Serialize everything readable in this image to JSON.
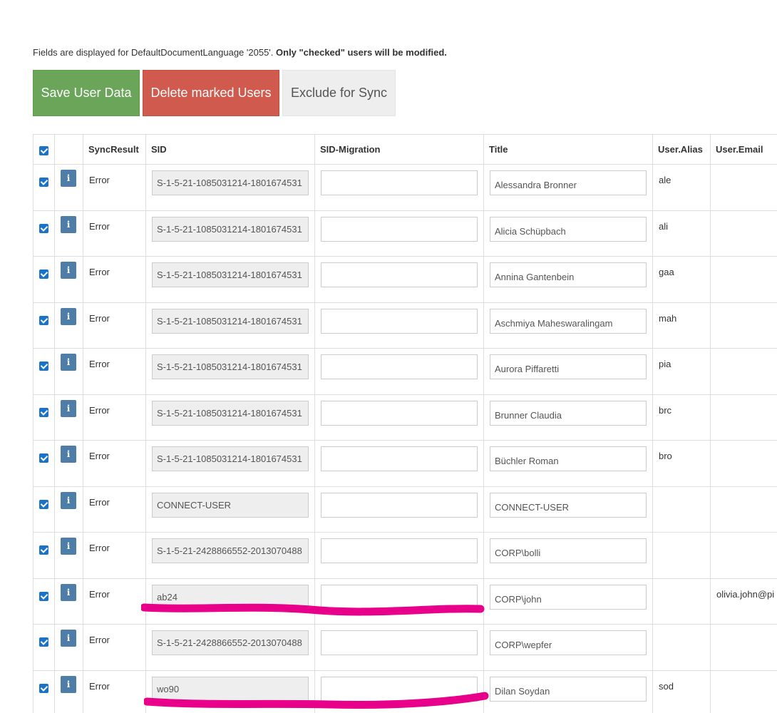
{
  "info": {
    "prefix": "Fields are displayed for DefaultDocumentLanguage '2055'. ",
    "bold": "Only \"checked\" users will be modified."
  },
  "toolbar": {
    "save_label": "Save User Data",
    "delete_label": "Delete marked Users",
    "exclude_label": "Exclude for Sync"
  },
  "table": {
    "headers": {
      "syncresult": "SyncResult",
      "sid": "SID",
      "sid_migration": "SID-Migration",
      "title": "Title",
      "alias": "User.Alias",
      "email": "User.Email"
    },
    "info_label": "i",
    "rows": [
      {
        "result": "Error",
        "sid": "S-1-5-21-1085031214-1801674531",
        "migration": "",
        "title": "Alessandra Bronner",
        "alias": "ale",
        "email": ""
      },
      {
        "result": "Error",
        "sid": "S-1-5-21-1085031214-1801674531",
        "migration": "",
        "title": "Alicia Schüpbach",
        "alias": "ali",
        "email": ""
      },
      {
        "result": "Error",
        "sid": "S-1-5-21-1085031214-1801674531",
        "migration": "",
        "title": "Annina Gantenbein",
        "alias": "gaa",
        "email": ""
      },
      {
        "result": "Error",
        "sid": "S-1-5-21-1085031214-1801674531",
        "migration": "",
        "title": "Aschmiya Maheswaralingam",
        "alias": "mah",
        "email": ""
      },
      {
        "result": "Error",
        "sid": "S-1-5-21-1085031214-1801674531",
        "migration": "",
        "title": "Aurora Piffaretti",
        "alias": "pia",
        "email": ""
      },
      {
        "result": "Error",
        "sid": "S-1-5-21-1085031214-1801674531",
        "migration": "",
        "title": "Brunner Claudia",
        "alias": "brc",
        "email": ""
      },
      {
        "result": "Error",
        "sid": "S-1-5-21-1085031214-1801674531",
        "migration": "",
        "title": "Büchler Roman",
        "alias": "bro",
        "email": ""
      },
      {
        "result": "Error",
        "sid": "CONNECT-USER",
        "migration": "",
        "title": "CONNECT-USER",
        "alias": "",
        "email": ""
      },
      {
        "result": "Error",
        "sid": "S-1-5-21-2428866552-2013070488",
        "migration": "",
        "title": "CORP\\bolli",
        "alias": "",
        "email": ""
      },
      {
        "result": "Error",
        "sid": "ab24",
        "migration": "",
        "title": "CORP\\john",
        "alias": "",
        "email": "olivia.john@pi"
      },
      {
        "result": "Error",
        "sid": "S-1-5-21-2428866552-2013070488",
        "migration": "",
        "title": "CORP\\wepfer",
        "alias": "",
        "email": ""
      },
      {
        "result": "Error",
        "sid": "wo90",
        "migration": "",
        "title": "Dilan Soydan",
        "alias": "sod",
        "email": ""
      }
    ]
  },
  "colors": {
    "save": "#6aa55a",
    "delete": "#cf5a4d",
    "exclude": "#eeeeee",
    "info_button": "#4e7ea8",
    "checkbox": "#1a73c9",
    "highlight_marker": "#e8008a"
  }
}
